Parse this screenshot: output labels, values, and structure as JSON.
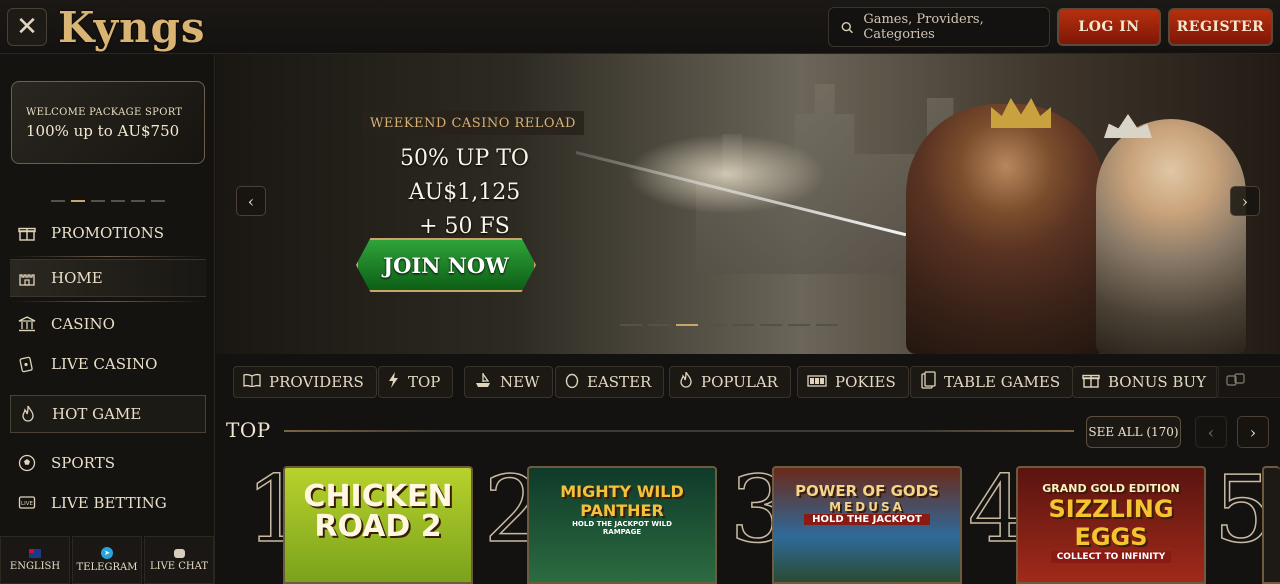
{
  "header": {
    "logo": "Kyngs",
    "search_placeholder": "Games, Providers, Categories",
    "login_label": "LOG IN",
    "register_label": "REGISTER"
  },
  "sidebar": {
    "promo_small": "WELCOME PACKAGE SPORT",
    "promo_big": "100% up to AU$750",
    "items": [
      {
        "label": "PROMOTIONS",
        "icon": "gift-icon"
      },
      {
        "label": "HOME",
        "icon": "castle-icon"
      },
      {
        "label": "CASINO",
        "icon": "casino-building-icon"
      },
      {
        "label": "LIVE CASINO",
        "icon": "live-casino-icon"
      },
      {
        "label": "HOT GAME",
        "icon": "flame-icon"
      },
      {
        "label": "SPORTS",
        "icon": "soccer-ball-icon"
      },
      {
        "label": "LIVE BETTING",
        "icon": "live-tv-icon"
      }
    ],
    "footer": [
      {
        "label": "ENGLISH",
        "icon": "australia-flag-icon"
      },
      {
        "label": "TELEGRAM",
        "icon": "telegram-icon"
      },
      {
        "label": "LIVE CHAT",
        "icon": "chat-icon"
      }
    ]
  },
  "banner": {
    "subtitle": "WEEKEND CASINO RELOAD",
    "headline_1": "50% UP TO AU$1,125",
    "headline_2": "+ 50 FS",
    "cta": "JOIN NOW"
  },
  "categories": [
    {
      "label": "PROVIDERS",
      "icon": "book-icon"
    },
    {
      "label": "TOP",
      "icon": "lightning-icon"
    },
    {
      "label": "NEW",
      "icon": "ship-icon"
    },
    {
      "label": "EASTER",
      "icon": "egg-icon"
    },
    {
      "label": "POPULAR",
      "icon": "flame-icon"
    },
    {
      "label": "POKIES",
      "icon": "slot-machine-icon"
    },
    {
      "label": "TABLE GAMES",
      "icon": "cards-icon"
    },
    {
      "label": "BONUS BUY",
      "icon": "gift-icon"
    }
  ],
  "top_section": {
    "title": "TOP",
    "see_all": "SEE ALL (170)",
    "games": [
      {
        "rank": "1",
        "line1": "CHICKEN",
        "line2": "ROAD 2",
        "line3": "",
        "bg": "#9fbf25"
      },
      {
        "rank": "2",
        "line1": "MIGHTY WILD",
        "line2": "PANTHER",
        "line3": "HOLD THE JACKPOT WILD RAMPAGE",
        "bg": "#1e5a3a"
      },
      {
        "rank": "3",
        "line1": "POWER OF GODS",
        "line2": "MEDUSA",
        "line3": "HOLD THE JACKPOT",
        "bg": "#2f6a9a"
      },
      {
        "rank": "4",
        "line1": "GRAND GOLD EDITION",
        "line2": "SIZZLING EGGS",
        "line3": "COLLECT TO INFINITY",
        "bg": "#7a1f1a"
      },
      {
        "rank": "5",
        "line1": "",
        "line2": "",
        "line3": "",
        "bg": "#1d1a15"
      }
    ]
  }
}
